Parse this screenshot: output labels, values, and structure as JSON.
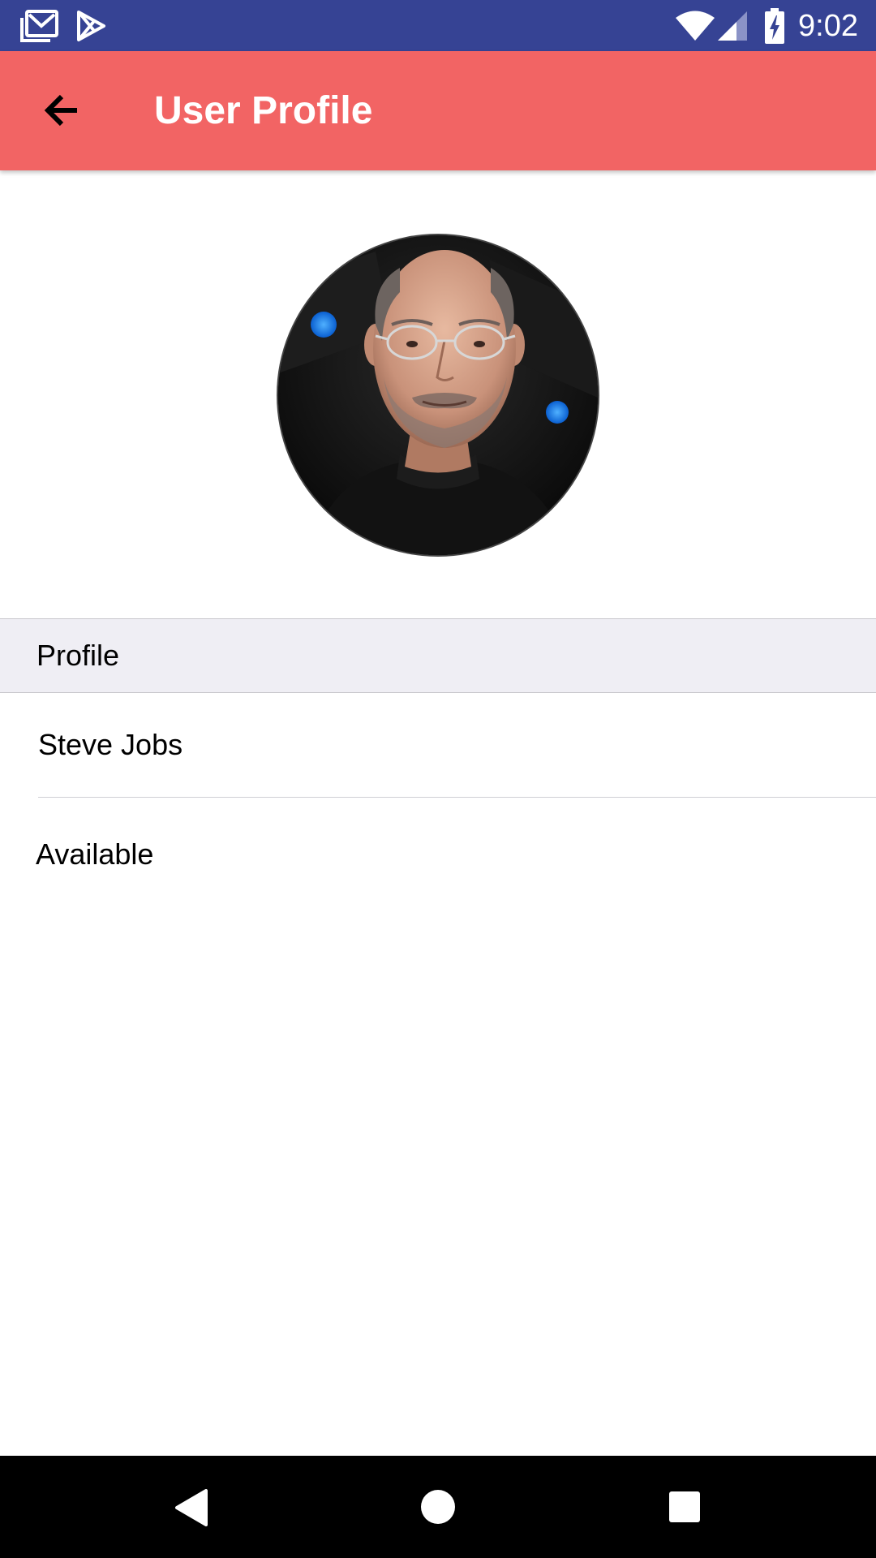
{
  "status_bar": {
    "time": "9:02",
    "icons": [
      "gmail-icon",
      "play-store-icon",
      "wifi-icon",
      "signal-icon",
      "battery-charging-icon"
    ]
  },
  "app_bar": {
    "title": "User Profile",
    "back_icon": "arrow-back-icon",
    "color": "#f26464"
  },
  "profile": {
    "avatar_icon": "profile-photo",
    "section_header": "Profile",
    "name": "Steve Jobs",
    "status": "Available"
  },
  "nav_bar": {
    "icons": [
      "back-triangle-icon",
      "home-circle-icon",
      "recents-square-icon"
    ]
  },
  "colors": {
    "status_bar": "#364394",
    "app_bar": "#f26464",
    "section_header_bg": "#efeef4",
    "nav_bar": "#000000"
  }
}
